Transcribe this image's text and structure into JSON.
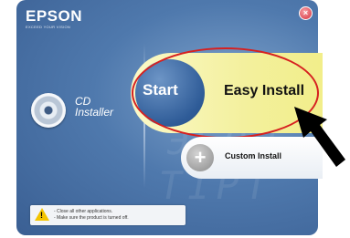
{
  "header": {
    "brand": "EPSON",
    "tagline": "EXCEED YOUR VISION",
    "close_glyph": "×"
  },
  "left_panel": {
    "title_line1": "CD",
    "title_line2": "Installer"
  },
  "buttons": {
    "easy_install": {
      "start_label": "Start",
      "label": "Easy Install"
    },
    "custom_install": {
      "label": "Custom Install",
      "icon_glyph": "+"
    }
  },
  "notice": {
    "icon_glyph": "!",
    "lines": [
      "- Close all other applications.",
      "- Make sure the product is turned off."
    ]
  },
  "colors": {
    "accent_yellow": "#f3f09d",
    "highlight_ring": "#d62020",
    "arrow": "#000000",
    "panel_blue": "#4f79ad"
  },
  "icons": {
    "cd": "cd-disc-icon",
    "warning": "warning-icon",
    "close": "close-icon",
    "custom": "plus-icon",
    "pointer": "arrow-pointer-icon"
  }
}
